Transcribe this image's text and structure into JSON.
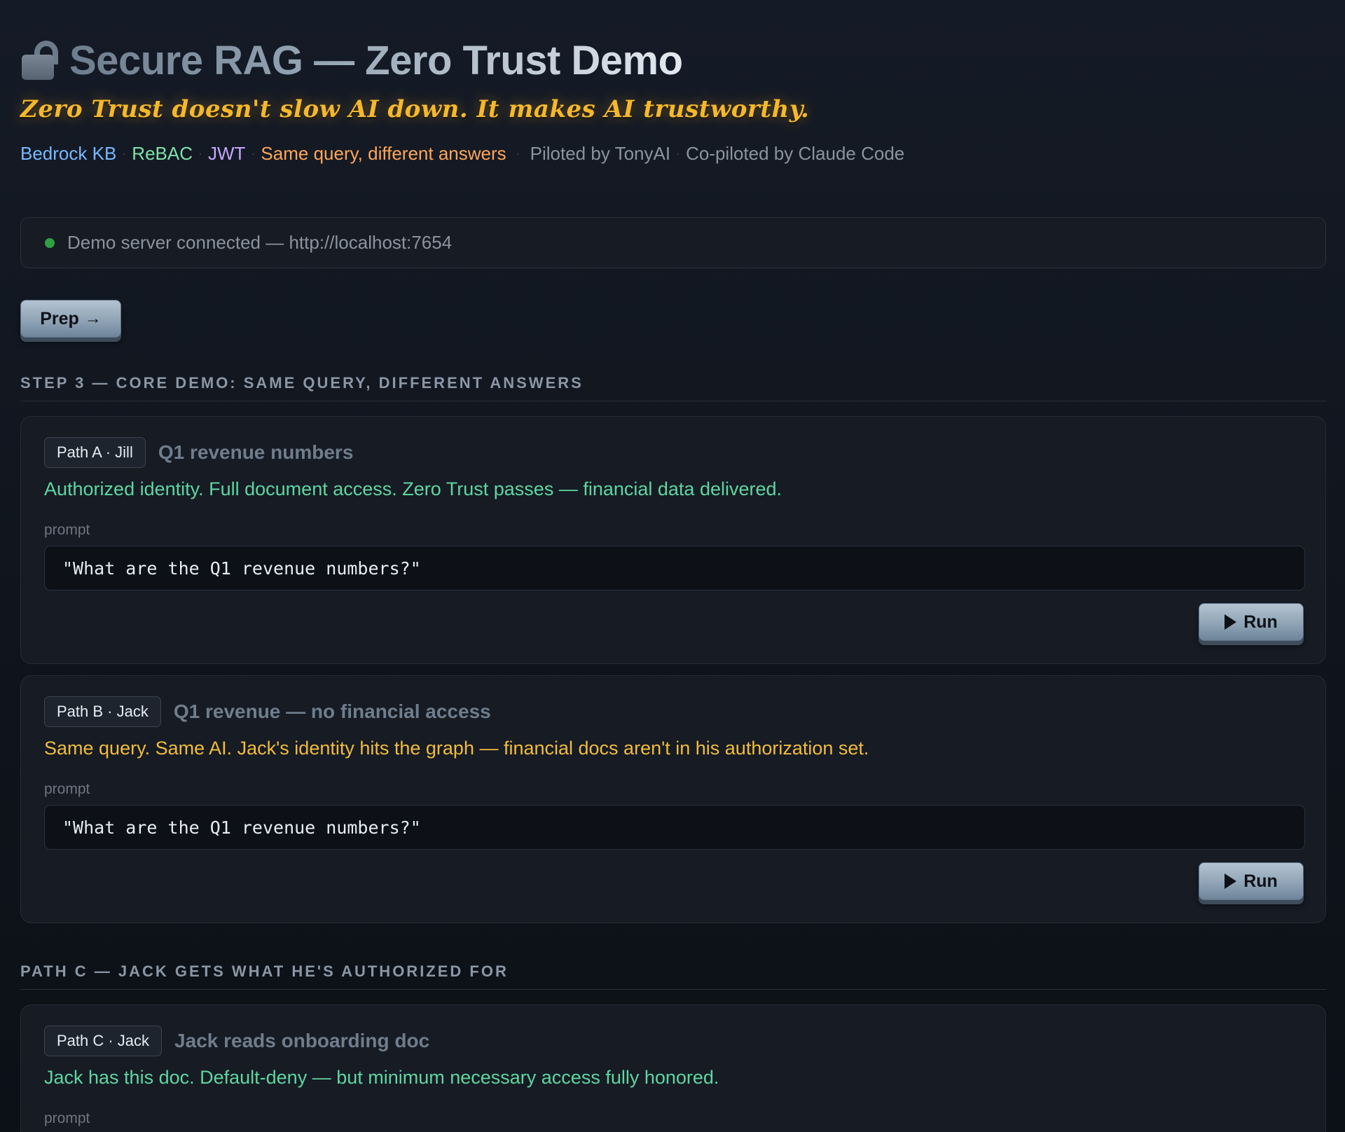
{
  "header": {
    "title": "Secure RAG — Zero Trust Demo",
    "tagline": "Zero Trust doesn't slow AI down. It makes AI trustworthy.",
    "tags": [
      "Bedrock KB",
      "ReBAC",
      "JWT",
      "Same query, different answers"
    ],
    "credits": [
      "Piloted by TonyAI",
      "Co-piloted by Claude Code"
    ],
    "separator": "·"
  },
  "status": {
    "text": "Demo server connected — http://localhost:7654",
    "color": "#2ea043"
  },
  "prep_button": {
    "label": "Prep",
    "icon": "arrow-right-icon",
    "arrow": "→"
  },
  "step3": {
    "heading": "STEP 3 — CORE DEMO: SAME QUERY, DIFFERENT ANSWERS",
    "cards": [
      {
        "badge": "Path A · Jill",
        "title": "Q1 revenue numbers",
        "description": "Authorized identity. Full document access. Zero Trust passes — financial data delivered.",
        "description_color": "#5fd6a0",
        "prompt_label": "prompt",
        "prompt": "\"What are the Q1 revenue numbers?\"",
        "run_label": "Run"
      },
      {
        "badge": "Path B · Jack",
        "title": "Q1 revenue — no financial access",
        "description": "Same query. Same AI. Jack's identity hits the graph — financial docs aren't in his authorization set.",
        "description_color": "#f2bc3c",
        "prompt_label": "prompt",
        "prompt": "\"What are the Q1 revenue numbers?\"",
        "run_label": "Run"
      }
    ]
  },
  "pathc": {
    "heading": "PATH C — JACK GETS WHAT HE'S AUTHORIZED FOR",
    "card": {
      "badge": "Path C · Jack",
      "title": "Jack reads onboarding doc",
      "description": "Jack has this doc. Default-deny — but minimum necessary access fully honored.",
      "description_color": "#5fd6a0",
      "prompt_label": "prompt"
    }
  }
}
